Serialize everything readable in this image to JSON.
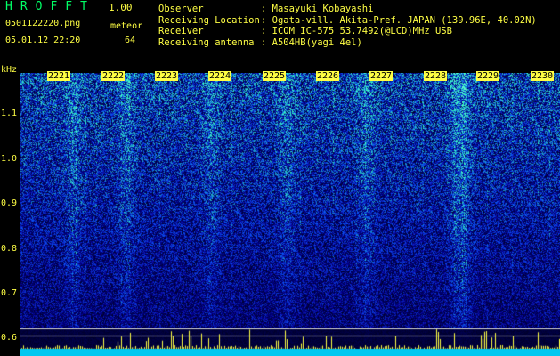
{
  "header": {
    "title": "HROFFT",
    "version": "1.00",
    "filename": "0501122220.png",
    "mode_label": "meteor",
    "datetime": "05.01.12 22:20",
    "count": "64"
  },
  "info": [
    {
      "key": "Observer",
      "value": ": Masayuki Kobayashi"
    },
    {
      "key": "Receiving Location",
      "value": ": Ogata-vill. Akita-Pref. JAPAN (139.96E, 40.02N)"
    },
    {
      "key": "Receiver",
      "value": ": ICOM IC-575 53.7492(@LCD)MHz USB"
    },
    {
      "key": "Receiving antenna",
      "value": ": A504HB(yagi 4el)"
    }
  ],
  "axes": {
    "y_unit": "kHz",
    "y_ticks": [
      "1.1",
      "1.0",
      "0.9",
      "0.8",
      "0.7",
      "0.6"
    ],
    "x_ticks": [
      "2221",
      "2222",
      "2223",
      "2224",
      "2225",
      "2226",
      "2227",
      "2228",
      "2229",
      "2230"
    ]
  },
  "colors": {
    "label": "#ffff44",
    "title": "#00ff66",
    "spectrum_low": "#000a5a",
    "spectrum_mid": "#1b55e0",
    "spectrum_high": "#28f0c8"
  }
}
